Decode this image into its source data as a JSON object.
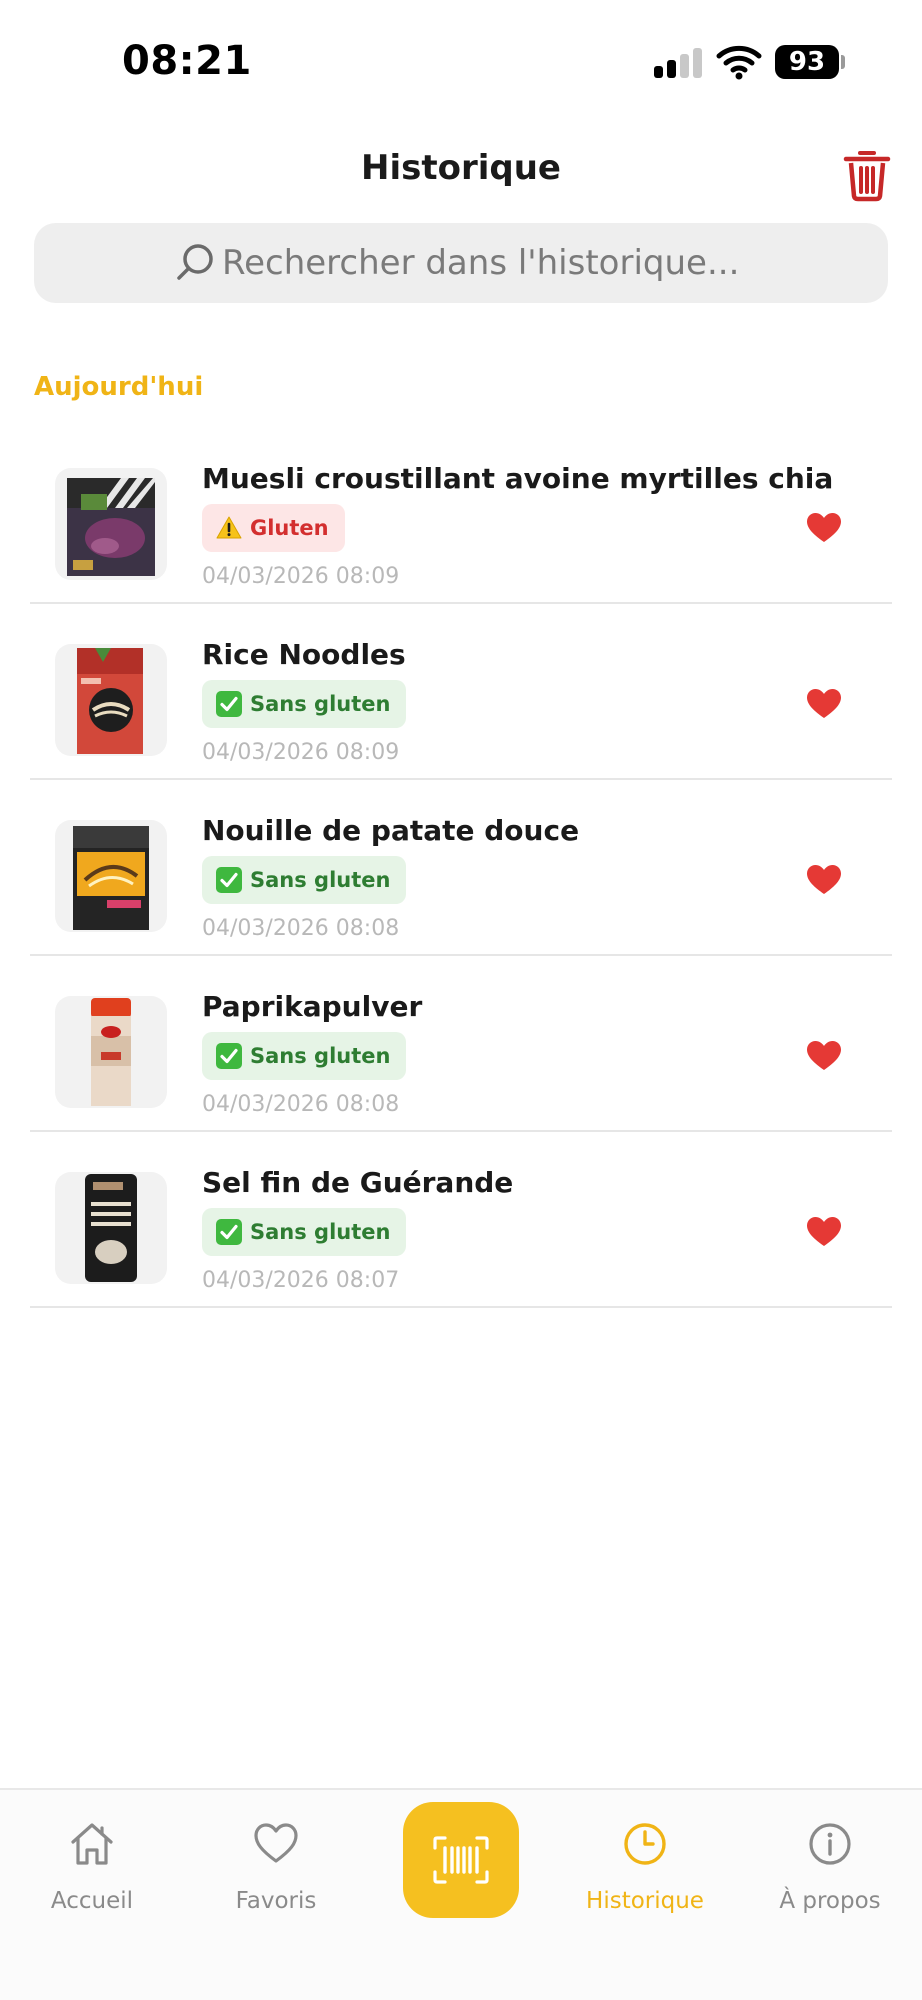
{
  "status_bar": {
    "time": "08:21",
    "battery": "93"
  },
  "header": {
    "title": "Historique"
  },
  "search": {
    "placeholder": "Rechercher dans l'historique..."
  },
  "section": {
    "title": "Aujourd'hui"
  },
  "history": [
    {
      "name": "Muesli croustillant avoine myrtilles chia",
      "badge": "Gluten",
      "badge_type": "warning",
      "badge_icon": "warning-icon",
      "date": "04/03/2026 08:09",
      "favorite": true
    },
    {
      "name": "Rice Noodles",
      "badge": "Sans gluten",
      "badge_type": "ok",
      "badge_icon": "check-icon",
      "date": "04/03/2026 08:09",
      "favorite": true
    },
    {
      "name": "Nouille de patate douce",
      "badge": "Sans gluten",
      "badge_type": "ok",
      "badge_icon": "check-icon",
      "date": "04/03/2026 08:08",
      "favorite": true
    },
    {
      "name": "Paprikapulver",
      "badge": "Sans gluten",
      "badge_type": "ok",
      "badge_icon": "check-icon",
      "date": "04/03/2026 08:08",
      "favorite": true
    },
    {
      "name": "Sel fin de Guérande",
      "badge": "Sans gluten",
      "badge_type": "ok",
      "badge_icon": "check-icon",
      "date": "04/03/2026 08:07",
      "favorite": true
    }
  ],
  "tabs": [
    {
      "label": "Accueil",
      "icon": "home-icon"
    },
    {
      "label": "Favoris",
      "icon": "heart-outline-icon"
    },
    {
      "label": "",
      "icon": "barcode-scan-icon"
    },
    {
      "label": "Historique",
      "icon": "clock-icon"
    },
    {
      "label": "À propos",
      "icon": "info-icon"
    }
  ],
  "colors": {
    "accent": "#f0b416",
    "danger": "#d32f2f",
    "success": "#2e7d32",
    "heart": "#e53935"
  }
}
